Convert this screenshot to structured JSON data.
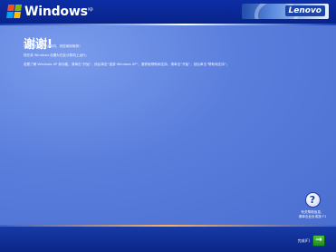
{
  "header": {
    "logo_text": "Windows",
    "logo_mark": "xp",
    "brand": "Lenovo"
  },
  "main": {
    "title": "谢谢!",
    "paragraphs": [
      "感谢您选择联想计算机，祝您使用愉快！",
      "现在将 Windows 设置为在此计算机上运行。",
      "若要了解 Windows XP 新功能，请单击“开始”，然后单击“漫游 Windows XP”。要获取帮助和支持，请单击“开始”，然后单击“帮助和支持”。"
    ]
  },
  "help": {
    "icon": "question-icon",
    "text_line1": "有关帮助信息，",
    "text_line2": "请单击此处或按 F1"
  },
  "footer": {
    "next_label": "完成(F)",
    "next_icon": "arrow-right-icon"
  }
}
